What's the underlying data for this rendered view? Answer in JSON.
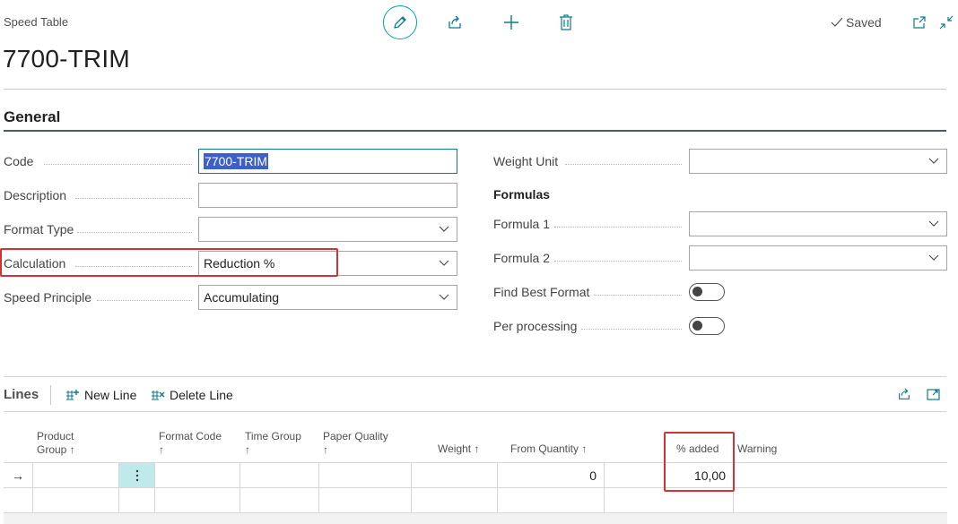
{
  "page": {
    "caption": "Speed Table",
    "title": "7700-TRIM",
    "saved_label": "Saved"
  },
  "toolbar": {
    "edit_icon": "pencil-icon",
    "share_icon": "share-icon",
    "new_icon": "plus-icon",
    "delete_icon": "trash-icon"
  },
  "general": {
    "title": "General",
    "left_fields": [
      {
        "label": "Code",
        "value": "7700-TRIM",
        "type": "text"
      },
      {
        "label": "Description",
        "value": "",
        "type": "text"
      },
      {
        "label": "Format Type",
        "value": "",
        "type": "select"
      },
      {
        "label": "Calculation",
        "value": "Reduction %",
        "type": "select"
      },
      {
        "label": "Speed Principle",
        "value": "Accumulating",
        "type": "select"
      }
    ],
    "weight_unit": {
      "label": "Weight Unit",
      "value": ""
    },
    "formulas_title": "Formulas",
    "formula1": {
      "label": "Formula 1",
      "value": ""
    },
    "formula2": {
      "label": "Formula 2",
      "value": ""
    },
    "find_best_format": {
      "label": "Find Best Format",
      "value": false
    },
    "per_processing": {
      "label": "Per processing",
      "value": false
    }
  },
  "lines": {
    "title": "Lines",
    "new_line": "New Line",
    "delete_line": "Delete Line",
    "columns": {
      "product_group_1": "Product",
      "product_group_2": "Group ↑",
      "format_code": "Format Code",
      "format_code_sort": "↑",
      "time_group": "Time Group",
      "time_group_sort": "↑",
      "paper_quality": "Paper Quality",
      "paper_quality_sort": "↑",
      "weight": "Weight ↑",
      "from_quantity": "From Quantity ↑",
      "pct_added": "% added",
      "warning": "Warning"
    },
    "rows": [
      {
        "marker": "→",
        "product_group": "",
        "format_code": "",
        "time_group": "",
        "paper_quality": "",
        "weight": "",
        "from_quantity": "0",
        "pct_added": "10,00",
        "warning": ""
      },
      {
        "marker": "",
        "product_group": "",
        "format_code": "",
        "time_group": "",
        "paper_quality": "",
        "weight": "",
        "from_quantity": "",
        "pct_added": "",
        "warning": ""
      }
    ]
  },
  "colors": {
    "accent": "#00a3a3",
    "highlight": "#d13438",
    "selection": "#3c5fc9"
  }
}
